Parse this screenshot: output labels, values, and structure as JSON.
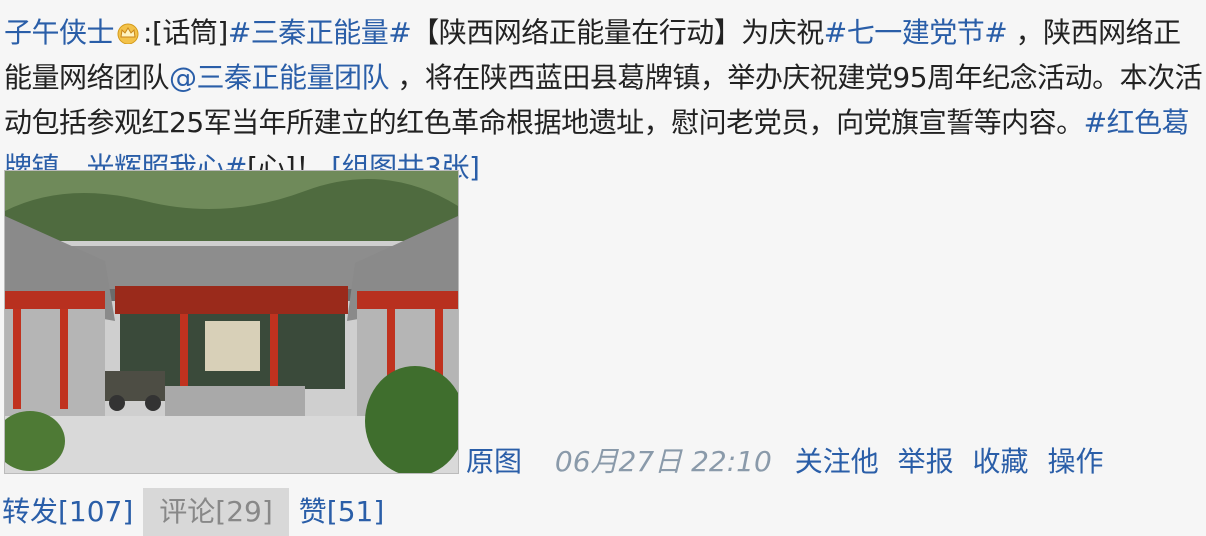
{
  "post": {
    "author": "子午侠士",
    "author_badge": "crown-icon",
    "segments": [
      {
        "type": "text",
        "value": ":[话筒]"
      },
      {
        "type": "link",
        "value": "#三秦正能量#"
      },
      {
        "type": "text",
        "value": "【陕西网络正能量在行动】为庆祝"
      },
      {
        "type": "link",
        "value": "#七一建党节#"
      },
      {
        "type": "text",
        "value": " ，陕西网络正能量网络团队"
      },
      {
        "type": "link",
        "value": "@三秦正能量团队"
      },
      {
        "type": "text",
        "value": " ，将在陕西蓝田县葛牌镇，举办庆祝建党95周年纪念活动。本次活动包括参观红25军当年所建立的红色革命根据地遗址，慰问老党员，向党旗宣誓等内容。"
      },
      {
        "type": "link",
        "value": "#红色葛牌镇，光辉照我心#"
      },
      {
        "type": "text",
        "value": "[心]！ "
      },
      {
        "type": "link",
        "value": " [组图共3张]"
      }
    ],
    "image_alt": "red revolutionary site courtyard with traditional buildings",
    "original_image_label": "原图",
    "timestamp": "06月27日 22:10",
    "follow_label": "关注他",
    "report_label": "举报",
    "favorite_label": "收藏",
    "operate_label": "操作"
  },
  "actions": {
    "forward_label": "转发[107]",
    "comment_label": "评论[29]",
    "like_label": "赞[51]"
  },
  "colors": {
    "link": "#2a5ea8",
    "background": "#f6f6f6",
    "timestamp": "#8a9aaa",
    "comment_bg": "#d8d8d8"
  }
}
